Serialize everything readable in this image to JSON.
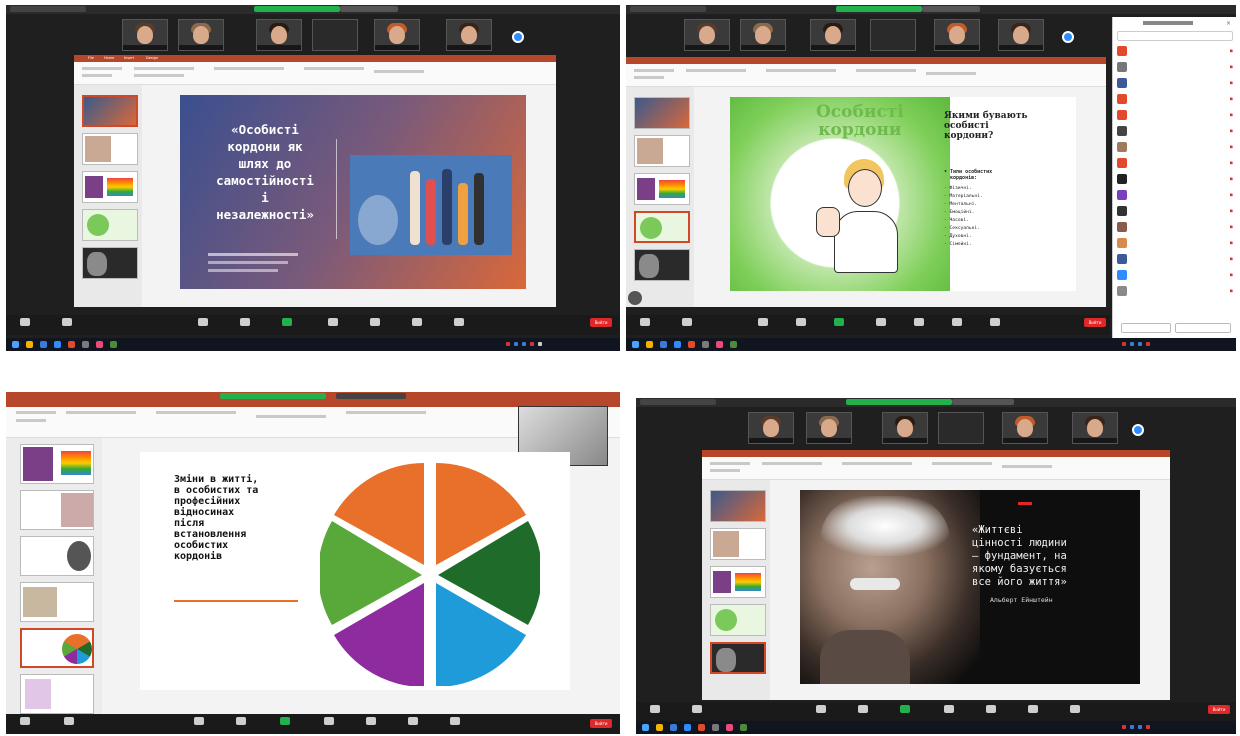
{
  "shot1": {
    "slide_title": "«Особисті\nкордони як\nшлях до\nсамостійності\nі\nнезалежності»",
    "leave_label": "Вийти"
  },
  "shot2": {
    "slide_heading": "Особисті\nкордони",
    "slide_question": "Якими бувають\nособисті\nкордони?",
    "list_title": "• Типи особистих\n  кордонів:",
    "list_items": [
      "- Фізичні.",
      "- Матеріальні.",
      "- Ментальні.",
      "- Емоційні.",
      "- Часові.",
      "- Сексуальні.",
      "- Духовні.",
      "- Сімейні."
    ],
    "leave_label": "Вийти"
  },
  "shot3": {
    "slide_text": "Зміни в житті,\nв особистих та\nпрофесійних\nвідносинах\nпісля\nвстановлення\nособистих\nкордонів",
    "leave_label": "Вийти"
  },
  "shot4": {
    "quote": "«Життєві\nцінності людини\n– фундамент, на\nякому базується\nвсе його життя»",
    "author": "Альберт Ейнштейн",
    "leave_label": "Вийти"
  },
  "colors": {
    "ppt_red": "#b7472a",
    "zoom_green": "#22b14c",
    "zoom_blue": "#2d8cff",
    "leave_red": "#e02828"
  }
}
